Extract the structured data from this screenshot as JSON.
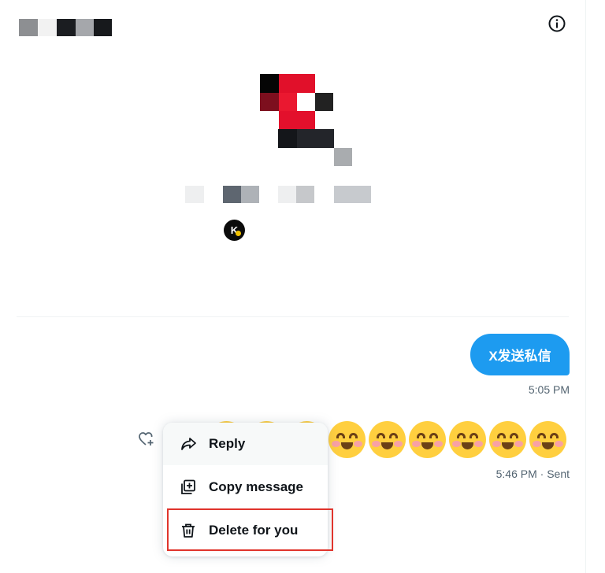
{
  "header": {
    "info_icon": "info-circle-icon"
  },
  "profile": {
    "badge_letter": "K",
    "badge_icon": "verified-affiliate-badge-icon"
  },
  "messages": {
    "sent": {
      "text": "X发送私信",
      "time": "5:05 PM"
    },
    "received": {
      "emoji": "☺️",
      "emoji_count": 9,
      "meta": "5:46 PM · Sent"
    }
  },
  "context_menu": {
    "items": [
      {
        "label": "Reply",
        "icon": "reply-arrow-icon"
      },
      {
        "label": "Copy message",
        "icon": "copy-icon"
      },
      {
        "label": "Delete for you",
        "icon": "trash-icon"
      }
    ]
  },
  "colors": {
    "accent": "#1d9bf0",
    "text_primary": "#0f1419",
    "text_secondary": "#536471",
    "highlight_border": "#e0342c"
  }
}
